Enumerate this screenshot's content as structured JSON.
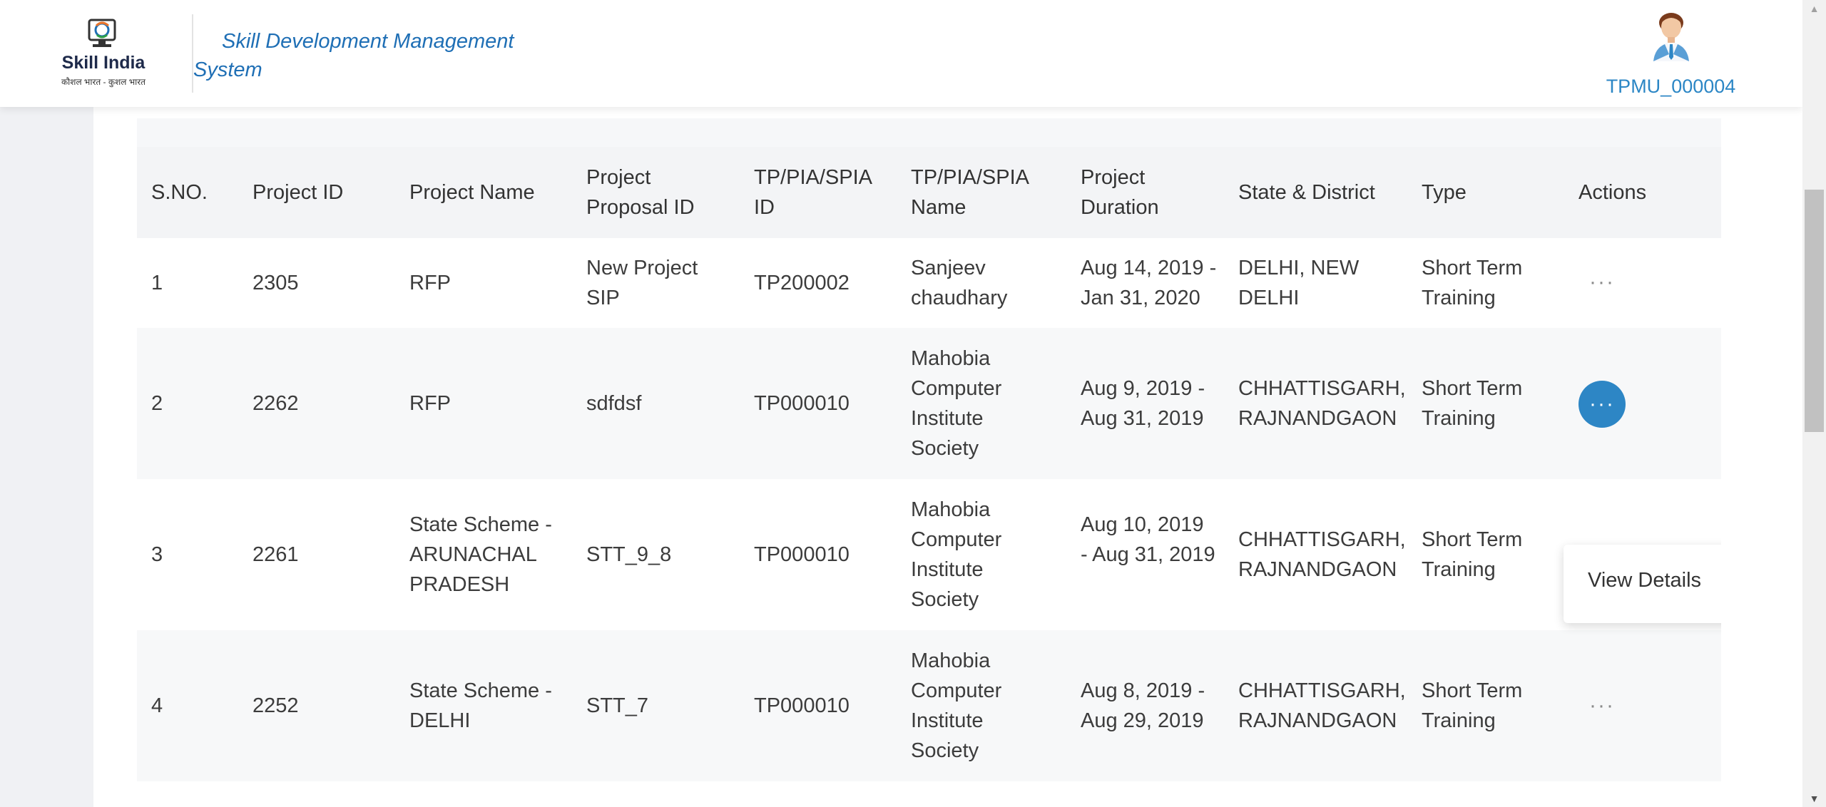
{
  "header": {
    "logo_text": "Skill India",
    "logo_tagline": "कौशल भारत - कुशल भारत",
    "app_title": "Skill Development Management System",
    "user_id": "TPMU_000004"
  },
  "table": {
    "columns": [
      "S.NO.",
      "Project ID",
      "Project Name",
      "Project Proposal ID",
      "TP/PIA/SPIA ID",
      "TP/PIA/SPIA Name",
      "Project Duration",
      "State & District",
      "Type",
      "Actions"
    ],
    "rows": [
      {
        "sno": "1",
        "project_id": "2305",
        "project_name": "RFP",
        "proposal_id": "New Project SIP",
        "tp_id": "TP200002",
        "tp_name": "Sanjeev chaudhary",
        "duration": "Aug 14, 2019 - Jan 31, 2020",
        "state_district": "DELHI, NEW DELHI",
        "type": "Short Term Training",
        "action": "···"
      },
      {
        "sno": "2",
        "project_id": "2262",
        "project_name": "RFP",
        "proposal_id": "sdfdsf",
        "tp_id": "TP000010",
        "tp_name": "Mahobia Computer Institute Society",
        "duration": "Aug 9, 2019 - Aug 31, 2019",
        "state_district": "CHHATTISGARH, RAJNANDGAON",
        "type": "Short Term Training",
        "action": "···"
      },
      {
        "sno": "3",
        "project_id": "2261",
        "project_name": "State Scheme - ARUNACHAL PRADESH",
        "proposal_id": "STT_9_8",
        "tp_id": "TP000010",
        "tp_name": "Mahobia Computer Institute Society",
        "duration": "Aug 10, 2019 - Aug 31, 2019",
        "state_district": "CHHATTISGARH, RAJNANDGAON",
        "type": "Short Term Training",
        "action": "···"
      },
      {
        "sno": "4",
        "project_id": "2252",
        "project_name": "State Scheme - DELHI",
        "proposal_id": "STT_7",
        "tp_id": "TP000010",
        "tp_name": "Mahobia Computer Institute Society",
        "duration": "Aug 8, 2019 - Aug 29, 2019",
        "state_district": "CHHATTISGARH, RAJNANDGAON",
        "type": "Short Term Training",
        "action": "···"
      }
    ],
    "dropdown": {
      "view_details": "View Details"
    }
  },
  "scrollbar": {
    "up": "▲",
    "down": "▼"
  },
  "colors": {
    "accent": "#2d86c5",
    "title_blue": "#1f6fb5",
    "header_bg": "#f3f4f6"
  }
}
